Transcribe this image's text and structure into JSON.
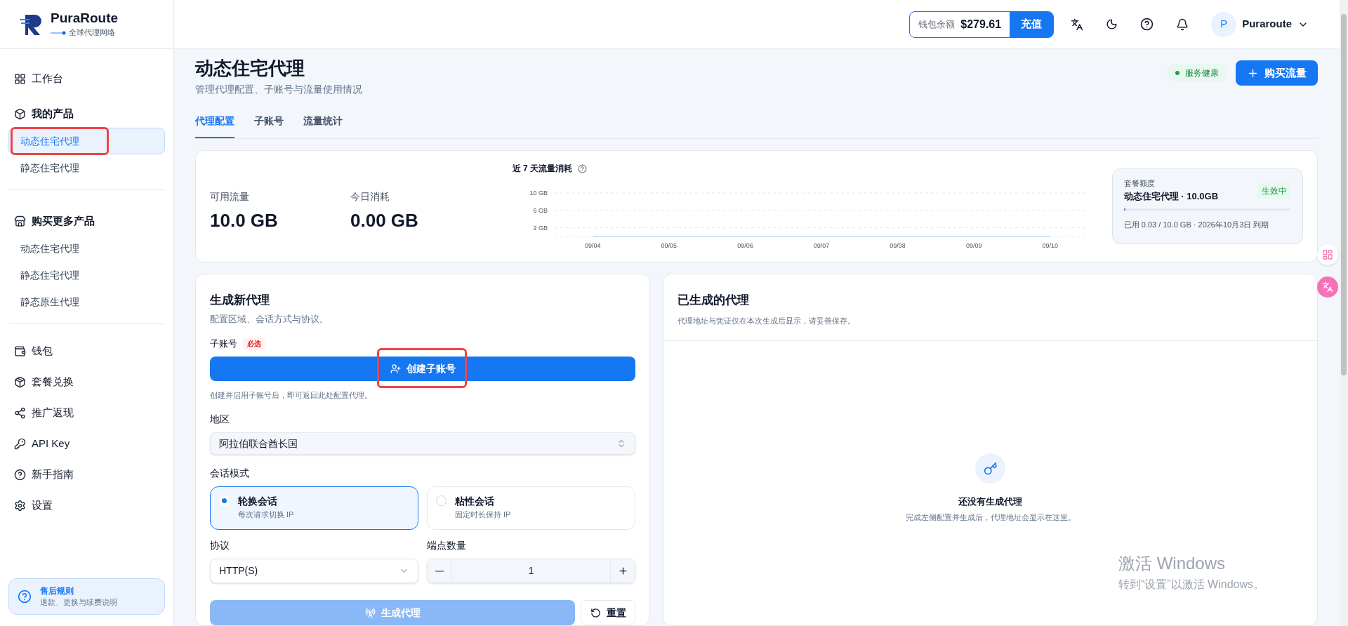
{
  "sidebar": {
    "brand": {
      "name": "PuraRoute",
      "tagline": "全球代理网络"
    },
    "nav": [
      {
        "kind": "link",
        "label": "工作台"
      },
      {
        "kind": "group",
        "label": "我的产品",
        "children": [
          {
            "label": "动态住宅代理",
            "selected": true,
            "highlighted": true
          },
          {
            "label": "静态住宅代理",
            "selected": false,
            "highlighted": false
          }
        ]
      },
      {
        "kind": "group",
        "label": "购买更多产品",
        "children": [
          {
            "label": "动态住宅代理",
            "selected": false,
            "highlighted": false
          },
          {
            "label": "静态住宅代理",
            "selected": false,
            "highlighted": false
          },
          {
            "label": "静态原生代理",
            "selected": false,
            "highlighted": false
          }
        ]
      },
      {
        "kind": "link",
        "label": "钱包"
      },
      {
        "kind": "link",
        "label": "套餐兑换"
      },
      {
        "kind": "link",
        "label": "推广返现"
      },
      {
        "kind": "link",
        "label": "API Key"
      },
      {
        "kind": "link",
        "label": "新手指南"
      },
      {
        "kind": "link",
        "label": "设置"
      }
    ],
    "help_card": {
      "title": "售后规则",
      "text": "退款、更换与续费说明"
    }
  },
  "header": {
    "wallet": {
      "label": "钱包余额",
      "amount": "$279.61",
      "button": "充值"
    },
    "user": {
      "initial": "P",
      "name": "Puraroute"
    }
  },
  "page": {
    "title": "动态住宅代理",
    "subtitle": "管理代理配置、子账号与流量使用情况",
    "status": "服务健康",
    "buy_button": "购买流量"
  },
  "tabs": [
    {
      "label": "代理配置",
      "selected": true
    },
    {
      "label": "子账号",
      "selected": false
    },
    {
      "label": "流量统计",
      "selected": false
    }
  ],
  "stats": [
    {
      "label": "可用流量",
      "value": "10.0 GB"
    },
    {
      "label": "今日消耗",
      "value": "0.00 GB"
    }
  ],
  "usage_chart": {
    "chart_data": {
      "type": "line",
      "title": "近 7 天流量消耗",
      "categories": [
        "09/04",
        "09/05",
        "09/06",
        "09/07",
        "09/08",
        "09/09",
        "09/10"
      ],
      "series": [
        {
          "color": "#bfdbfe",
          "values": [
            0,
            0,
            0,
            0,
            0,
            0,
            0
          ]
        }
      ],
      "ylim": [
        0,
        10
      ],
      "yticks": [
        {
          "value": 2,
          "label": "2 GB"
        },
        {
          "value": 6,
          "label": "6 GB"
        },
        {
          "value": 10,
          "label": "10 GB"
        }
      ]
    }
  },
  "quota": {
    "label": "套餐额度",
    "name": "动态住宅代理 · 10.0GB",
    "badge": "生效中",
    "level": 0.003,
    "note": "已用 0.03 / 10.0 GB · 2026年10月3日 到期"
  },
  "generator": {
    "title": "生成新代理",
    "subtitle": "配置区域、会话方式与协议。",
    "subaccount_label": "子账号",
    "required": "必选",
    "create_button": "创建子账号",
    "create_highlighted": true,
    "hint": "创建并启用子账号后，即可返回此处配置代理。",
    "region_label": "地区",
    "region": "阿拉伯联合酋长国",
    "session_label": "会话模式",
    "sessions": [
      {
        "title": "轮换会话",
        "desc": "每次请求切换 IP",
        "selected": true
      },
      {
        "title": "粘性会话",
        "desc": "固定时长保持 IP",
        "selected": false
      }
    ],
    "protocol_label": "协议",
    "protocol": "HTTP(S)",
    "count_label": "端点数量",
    "count": "1",
    "generate_button": "生成代理",
    "generate_disabled": true,
    "reset_button": "重置"
  },
  "results": {
    "title": "已生成的代理",
    "subtitle": "代理地址与凭证仅在本次生成后显示，请妥善保存。",
    "empty_title": "还没有生成代理",
    "empty_text": "完成左侧配置并生成后，代理地址会显示在这里。"
  },
  "os_notice": {
    "title": "激活 Windows",
    "text": "转到“设置”以激活 Windows。"
  }
}
